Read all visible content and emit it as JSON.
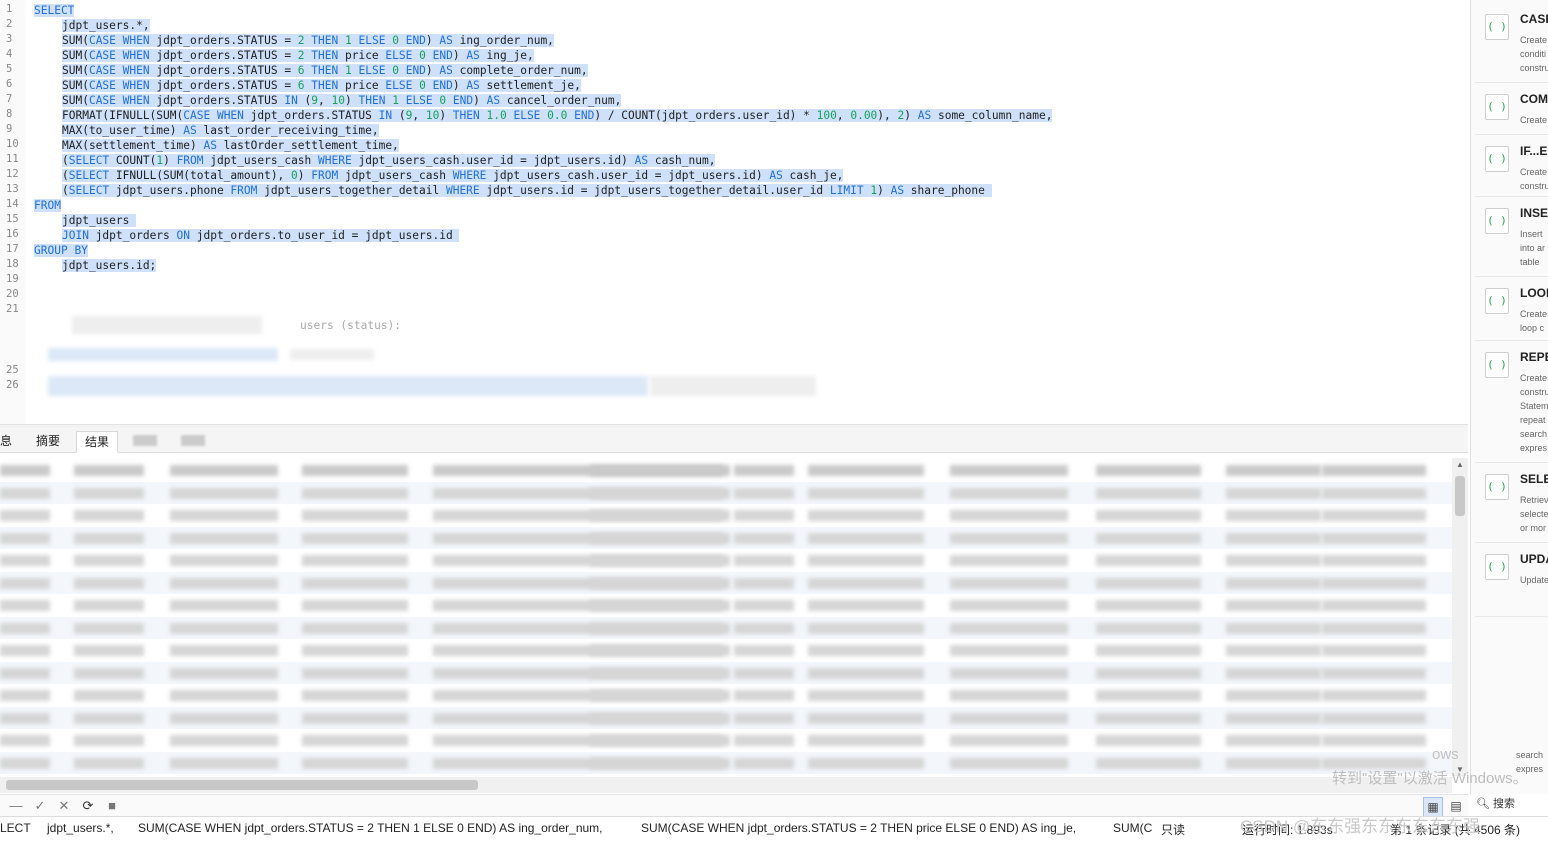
{
  "editor": {
    "lines": [
      {
        "n": "1",
        "text": "SELECT",
        "indent": 0
      },
      {
        "n": "2",
        "text": "jdpt_users.*,",
        "indent": 1
      },
      {
        "n": "3",
        "text": "SUM(CASE WHEN jdpt_orders.STATUS = 2 THEN 1 ELSE 0 END) AS ing_order_num,",
        "indent": 1
      },
      {
        "n": "4",
        "text": "SUM(CASE WHEN jdpt_orders.STATUS = 2 THEN price ELSE 0 END) AS ing_je,",
        "indent": 1
      },
      {
        "n": "5",
        "text": "SUM(CASE WHEN jdpt_orders.STATUS = 6 THEN 1 ELSE 0 END) AS complete_order_num,",
        "indent": 1
      },
      {
        "n": "6",
        "text": "SUM(CASE WHEN jdpt_orders.STATUS = 6 THEN price ELSE 0 END) AS settlement_je,",
        "indent": 1
      },
      {
        "n": "7",
        "text": "SUM(CASE WHEN jdpt_orders.STATUS IN (9, 10) THEN 1 ELSE 0 END) AS cancel_order_num,",
        "indent": 1
      },
      {
        "n": "8",
        "text": "FORMAT(IFNULL(SUM(CASE WHEN jdpt_orders.STATUS IN (9, 10) THEN 1.0 ELSE 0.0 END) / COUNT(jdpt_orders.user_id) * 100, 0.00), 2) AS some_column_name,",
        "indent": 1
      },
      {
        "n": "9",
        "text": "MAX(to_user_time) AS last_order_receiving_time,",
        "indent": 1
      },
      {
        "n": "10",
        "text": "MAX(settlement_time) AS lastOrder_settlement_time,",
        "indent": 1
      },
      {
        "n": "11",
        "text": "(SELECT COUNT(1) FROM jdpt_users_cash WHERE jdpt_users_cash.user_id = jdpt_users.id) AS cash_num,",
        "indent": 1
      },
      {
        "n": "12",
        "text": "(SELECT IFNULL(SUM(total_amount), 0) FROM jdpt_users_cash WHERE jdpt_users_cash.user_id = jdpt_users.id) AS cash_je,",
        "indent": 1
      },
      {
        "n": "13",
        "text": "(SELECT jdpt_users.phone FROM jdpt_users_together_detail WHERE jdpt_users.id = jdpt_users_together_detail.user_id LIMIT 1) AS share_phone ",
        "indent": 1
      },
      {
        "n": "14",
        "text": "FROM",
        "indent": 0
      },
      {
        "n": "15",
        "text": "jdpt_users ",
        "indent": 1
      },
      {
        "n": "16",
        "text": "JOIN jdpt_orders ON jdpt_orders.to_user_id = jdpt_users.id ",
        "indent": 1
      },
      {
        "n": "17",
        "text": "GROUP BY",
        "indent": 0
      },
      {
        "n": "18",
        "text": "jdpt_users.id;",
        "indent": 1
      },
      {
        "n": "19",
        "text": "",
        "indent": 0
      },
      {
        "n": "20",
        "text": "",
        "indent": 0
      },
      {
        "n": "21",
        "text": "",
        "indent": 0
      }
    ],
    "blurred_line_fragment": "users (status):",
    "line_25": "25",
    "line_26": "26"
  },
  "tabs": [
    {
      "label": "息",
      "active": false
    },
    {
      "label": "摘要",
      "active": false
    },
    {
      "label": "结果",
      "active": true
    }
  ],
  "status": {
    "left_fragment": "LECT",
    "col1": "jdpt_users.*,",
    "col2": "SUM(CASE WHEN jdpt_orders.STATUS = 2 THEN 1 ELSE 0 END) AS ing_order_num,",
    "col3": "SUM(CASE WHEN jdpt_orders.STATUS = 2 THEN price ELSE 0 END) AS ing_je,",
    "col4": "SUM(C",
    "readonly": "只读",
    "runtime": "运行时间: 1.893s",
    "record": "第 1 条记录 (共 4506 条)"
  },
  "snippets": [
    {
      "title": "CASE",
      "desc": "Create\nconditi\nconstru"
    },
    {
      "title": "COM",
      "desc": "Create"
    },
    {
      "title": "IF...EI",
      "desc": "Create\nconstru"
    },
    {
      "title": "INSE",
      "desc": "Insert\ninto ar\ntable"
    },
    {
      "title": "LOOI",
      "desc": "Create\nloop c"
    },
    {
      "title": "REPE",
      "desc": "Create\nconstru\nStatem\nrepeat\nsearch\nexpres"
    },
    {
      "title": "SELE",
      "desc": "Retriev\nselecte\nor mor"
    },
    {
      "title": "UPDA",
      "desc": "Update"
    }
  ],
  "snippet_tail": {
    "desc": "search\nexpres"
  },
  "search_label": "搜索",
  "watermark_os": "ows",
  "watermark": "转到\"设置\"以激活 Windows。",
  "csdn": "CSDN @东东强东东东东东东强"
}
